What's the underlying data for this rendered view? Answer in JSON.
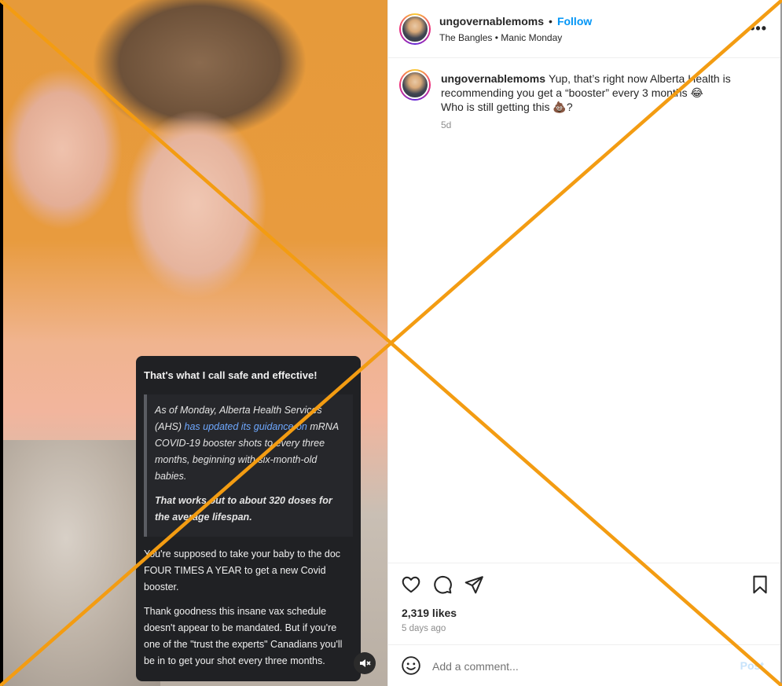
{
  "post": {
    "username": "ungovernablemoms",
    "separator": "•",
    "follow_label": "Follow",
    "audio": "The Bangles • Manic Monday",
    "more_label": "•••"
  },
  "caption": {
    "username": "ungovernablemoms",
    "text_line1": "Yup, that’s right now Alberta Health is recommending you get a “booster” every 3 months 😂",
    "text_line2": "Who is still getting this 💩?",
    "time": "5d"
  },
  "media_card": {
    "heading": "That's what I call safe and effective!",
    "quote_part1": "As of Monday, Alberta Health Services (AHS) ",
    "quote_link": "has updated its guidance on",
    "quote_part2": " mRNA COVID-19 booster shots to every three months, beginning with six-month-old babies.",
    "quote_bold": "That works out to about 320 doses for the average lifespan.",
    "body_p1": "You're supposed to take your baby to the doc FOUR TIMES A YEAR to get a new Covid booster.",
    "body_p2": "Thank goodness this insane vax schedule doesn't appear to be mandated. But if you're one of the \"trust the experts\" Canadians you'll be in to get your shot every three months."
  },
  "actions": {
    "likes": "2,319 likes",
    "date": "5 days ago"
  },
  "comment": {
    "placeholder": "Add a comment...",
    "post_label": "Post"
  },
  "icons": {
    "like": "heart-icon",
    "comment": "comment-bubble-icon",
    "share": "paper-plane-icon",
    "save": "bookmark-icon",
    "emoji": "smiley-icon",
    "mute": "speaker-muted-icon",
    "more": "more-options-icon"
  },
  "colors": {
    "follow_blue": "#0095f6",
    "overlay_x": "#f39c12",
    "post_disabled": "#c7e3fb"
  }
}
